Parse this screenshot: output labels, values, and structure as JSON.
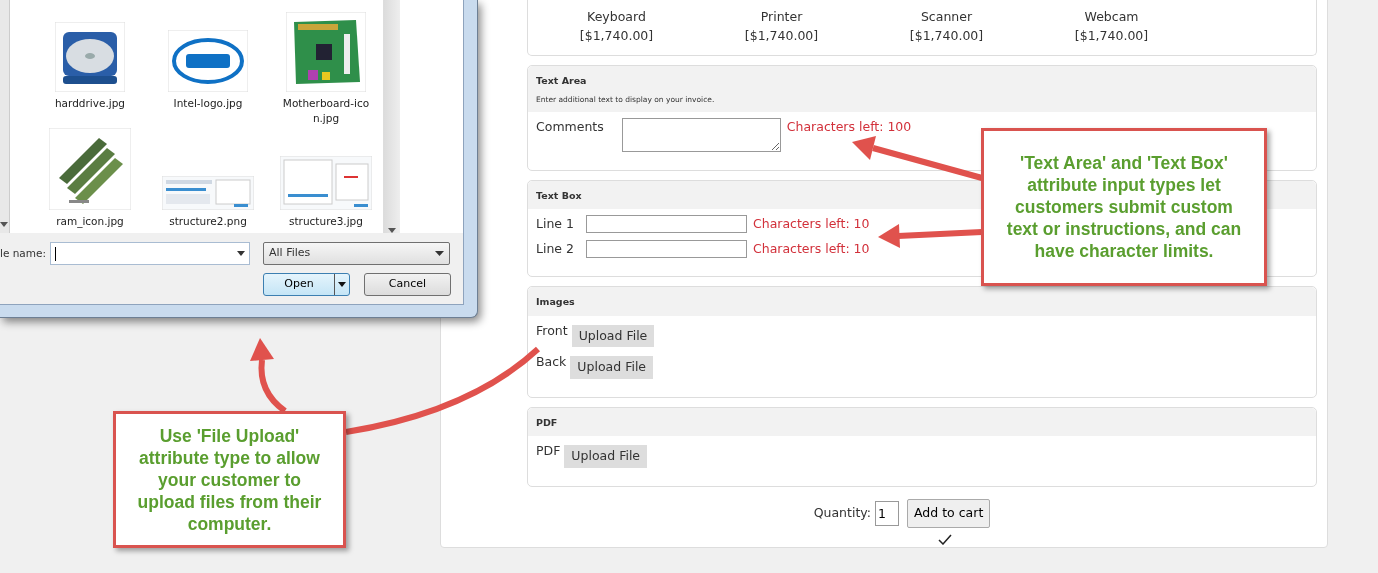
{
  "file_dialog": {
    "files": [
      {
        "name": "harddrive.jpg",
        "kind": "picture"
      },
      {
        "name": "Intel-logo.jpg",
        "kind": "picture"
      },
      {
        "name": "Motherboard-icon.jpg",
        "kind": "picture"
      },
      {
        "name": "ram_icon.jpg",
        "kind": "picture"
      },
      {
        "name": "structure2.png",
        "kind": "picture"
      },
      {
        "name": "structure3.jpg",
        "kind": "picture"
      }
    ],
    "file_name_label": "le name:",
    "file_type": "All Files",
    "buttons": [
      {
        "label": "Open",
        "kind": "split",
        "default": true
      },
      {
        "label": "Cancel",
        "kind": "plain",
        "default": false
      }
    ]
  },
  "products": [
    {
      "name": "Keyboard",
      "price": "[$1,740.00]"
    },
    {
      "name": "Printer",
      "price": "[$1,740.00]"
    },
    {
      "name": "Scanner",
      "price": "[$1,740.00]"
    },
    {
      "name": "Webcam",
      "price": "[$1,740.00]"
    }
  ],
  "sections": [
    {
      "title": "Text Area",
      "description": "Enter additional text to display on your invoice.",
      "fields": [
        {
          "kind": "textarea",
          "label": "Comments",
          "counter": "Characters left: 100"
        }
      ]
    },
    {
      "title": "Text Box",
      "fields": [
        {
          "kind": "text",
          "label": "Line 1",
          "counter": "Characters left: 10"
        },
        {
          "kind": "text",
          "label": "Line 2",
          "counter": "Characters left: 10"
        }
      ]
    },
    {
      "title": "Images",
      "fields": [
        {
          "kind": "upload",
          "label": "Front",
          "button": "Upload File"
        },
        {
          "kind": "upload",
          "label": "Back",
          "button": "Upload File"
        }
      ]
    },
    {
      "title": "PDF",
      "fields": [
        {
          "kind": "upload",
          "label": "PDF",
          "button": "Upload File"
        }
      ]
    }
  ],
  "quantity": {
    "label": "Quantity:",
    "value": "1"
  },
  "add_to_cart": "Add to cart",
  "callouts": [
    {
      "text": "'Text Area' and 'Text Box' attribute input types let customers submit custom text or instructions, and can have character limits.",
      "kind": "right"
    },
    {
      "text": "Use 'File Upload' attribute type to allow your customer to upload files from their computer.",
      "kind": "left"
    }
  ]
}
